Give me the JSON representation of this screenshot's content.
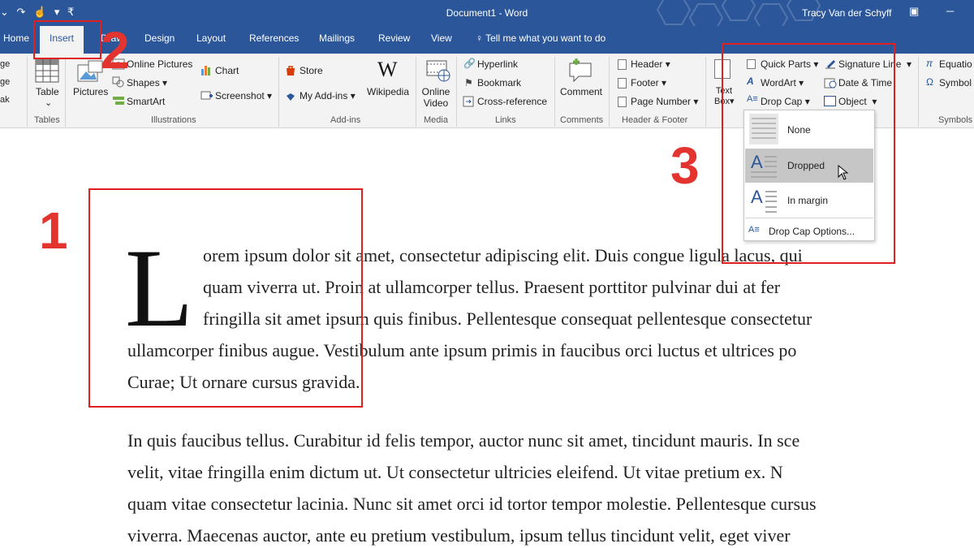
{
  "titlebar": {
    "doc_title": "Document1 - Word",
    "user": "Tracy Van der Schyff"
  },
  "tabs": [
    {
      "label": "Home"
    },
    {
      "label": "Insert"
    },
    {
      "label": "Draw"
    },
    {
      "label": "Design"
    },
    {
      "label": "Layout"
    },
    {
      "label": "References"
    },
    {
      "label": "Mailings"
    },
    {
      "label": "Review"
    },
    {
      "label": "View"
    }
  ],
  "tell_me": "Tell me what you want to do",
  "ribbon": {
    "pages_items": [
      "ge",
      "ge",
      "ak"
    ],
    "tables": {
      "table": "Table",
      "group": "Tables"
    },
    "illustrations": {
      "pictures": "Pictures",
      "online_pictures": "Online Pictures",
      "shapes": "Shapes",
      "smartart": "SmartArt",
      "chart": "Chart",
      "screenshot": "Screenshot",
      "group": "Illustrations"
    },
    "addins": {
      "store": "Store",
      "my_addins": "My Add-ins",
      "wikipedia": "Wikipedia",
      "group": "Add-ins"
    },
    "media": {
      "online_video_1": "Online",
      "online_video_2": "Video",
      "group": "Media"
    },
    "links": {
      "hyperlink": "Hyperlink",
      "bookmark": "Bookmark",
      "cross_reference": "Cross-reference",
      "group": "Links"
    },
    "comments": {
      "comment": "Comment",
      "group": "Comments"
    },
    "header_footer": {
      "header": "Header",
      "footer": "Footer",
      "page_number": "Page Number",
      "group": "Header & Footer"
    },
    "text": {
      "text_box_1": "Text",
      "text_box_2": "Box",
      "quick_parts": "Quick Parts",
      "wordart": "WordArt",
      "drop_cap": "Drop Cap",
      "signature_line": "Signature Line",
      "date_time": "Date & Time",
      "object": "Object"
    },
    "symbols": {
      "equation": "Equatio",
      "symbol": "Symbol",
      "group": "Symbols"
    }
  },
  "dropcap_menu": {
    "items": [
      {
        "label": "None"
      },
      {
        "label": "Dropped"
      },
      {
        "label": "In margin"
      }
    ],
    "options": "Drop Cap Options..."
  },
  "document": {
    "drop_cap_letter": "L",
    "para1_lines": [
      "orem ipsum dolor sit amet, consectetur adipiscing elit. Duis congue ligula lacus, qui",
      "quam viverra ut. Proin at ullamcorper tellus. Praesent porttitor pulvinar dui at fer",
      "fringilla sit amet ipsum quis finibus. Pellentesque consequat pellentesque consectetur",
      "ullamcorper finibus augue. Vestibulum ante ipsum primis in faucibus orci luctus et ultrices po",
      "Curae; Ut ornare cursus gravida."
    ],
    "para2_lines": [
      "In quis faucibus tellus. Curabitur id felis tempor, auctor nunc sit amet, tincidunt mauris. In sce",
      "velit, vitae fringilla enim dictum ut. Ut consectetur ultricies eleifend. Ut vitae pretium ex. N",
      "quam vitae consectetur lacinia. Nunc sit amet orci id tortor tempor molestie. Pellentesque cursus",
      "viverra. Maecenas auctor, ante eu pretium vestibulum, ipsum tellus tincidunt velit, eget viver"
    ]
  },
  "annotations": {
    "step1": "1",
    "step2": "2",
    "step3": "3"
  },
  "colors": {
    "brand": "#2b579a",
    "annotation": "#e3342f"
  }
}
